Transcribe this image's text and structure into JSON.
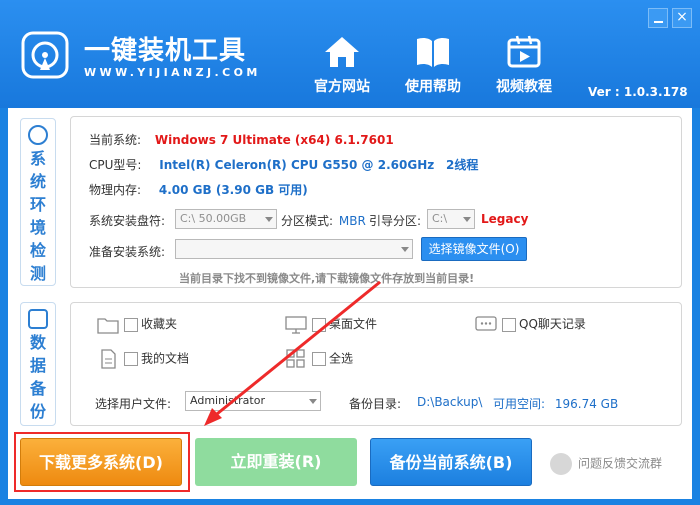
{
  "app": {
    "title": "一键装机工具",
    "subtitle": "WWW.YIJIANZJ.COM",
    "version": "Ver : 1.0.3.178",
    "close_glyph": "×"
  },
  "nav": [
    {
      "label": "官方网站",
      "icon": "home-icon"
    },
    {
      "label": "使用帮助",
      "icon": "book-icon"
    },
    {
      "label": "视频教程",
      "icon": "video-icon"
    }
  ],
  "system": {
    "section_title": "系统环境检测",
    "section_chars": [
      "系",
      "统",
      "环",
      "境",
      "检",
      "测"
    ],
    "os_label": "当前系统:",
    "os_value": "Windows 7 Ultimate (x64) 6.1.7601",
    "cpu_label": "CPU型号:",
    "cpu_value": "Intel(R) Celeron(R) CPU G550 @ 2.60GHz",
    "cpu_threads": "2线程",
    "mem_label": "物理内存:",
    "mem_value": "4.00 GB (3.90 GB 可用)",
    "drive_label": "系统安装盘符:",
    "drive_value": "C:\\    50.00GB",
    "partition_label": "分区模式:",
    "partition_value": "MBR",
    "boot_label": "引导分区:",
    "boot_value": "C:\\",
    "boot_mode": "Legacy",
    "prepare_label": "准备安装系统:",
    "prepare_value": "",
    "select_image_button": "选择镜像文件(O)",
    "notice": "当前目录下找不到镜像文件,请下载镜像文件存放到当前目录!"
  },
  "backup": {
    "section_chars": [
      "数",
      "据",
      "备",
      "份"
    ],
    "items": [
      {
        "label": "收藏夹",
        "icon": "folder-icon"
      },
      {
        "label": "桌面文件",
        "icon": "monitor-icon"
      },
      {
        "label": "QQ聊天记录",
        "icon": "chat-icon"
      },
      {
        "label": "我的文档",
        "icon": "document-icon"
      },
      {
        "label": "全选",
        "icon": "grid-icon"
      }
    ],
    "user_label": "选择用户文件:",
    "user_value": "Administrator",
    "dir_label": "备份目录:",
    "dir_value": "D:\\Backup\\",
    "space_label": "可用空间:",
    "space_value": "196.74 GB"
  },
  "actions": {
    "download": "下载更多系统(D)",
    "reinstall": "立即重装(R)",
    "backup": "备份当前系统(B)",
    "feedback": "问题反馈交流群"
  }
}
